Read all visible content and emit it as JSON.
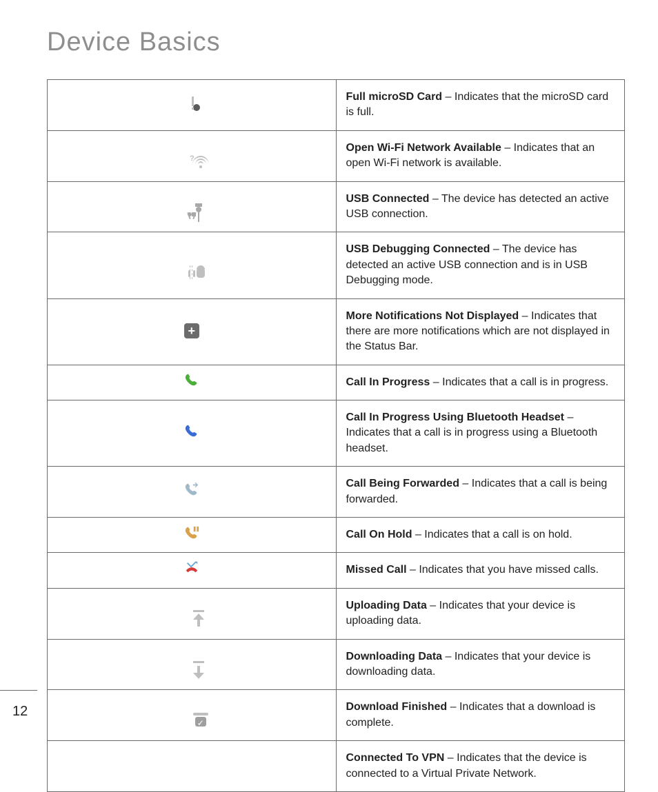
{
  "title": "Device Basics",
  "page_number": "12",
  "separator": " – ",
  "rows": [
    {
      "icon": "full-microsd-icon",
      "term": "Full microSD Card",
      "desc": "Indicates that the microSD card is full."
    },
    {
      "icon": "open-wifi-icon",
      "term": "Open Wi-Fi Network Available",
      "desc": "Indicates that an open Wi-Fi network is available."
    },
    {
      "icon": "usb-connected-icon",
      "term": "USB Connected",
      "desc": "The device has detected an active USB connection."
    },
    {
      "icon": "usb-debugging-icon",
      "term": "USB Debugging Connected",
      "desc": "The device has detected an active USB connection and is in USB Debugging mode."
    },
    {
      "icon": "more-notifications-icon",
      "term": "More Notifications Not Displayed",
      "desc": "Indicates that there are more notifications which are not displayed in the Status Bar."
    },
    {
      "icon": "call-in-progress-icon",
      "term": "Call In Progress",
      "desc": "Indicates that a call is in progress."
    },
    {
      "icon": "call-bluetooth-icon",
      "term": "Call In Progress Using Bluetooth Headset",
      "desc": "Indicates that a call is in progress using a Bluetooth headset."
    },
    {
      "icon": "call-forwarded-icon",
      "term": "Call Being Forwarded",
      "desc": "Indicates that a call is being forwarded."
    },
    {
      "icon": "call-on-hold-icon",
      "term": "Call On Hold",
      "desc": "Indicates that a call is on hold."
    },
    {
      "icon": "missed-call-icon",
      "term": "Missed Call",
      "desc": "Indicates that you have missed calls."
    },
    {
      "icon": "uploading-data-icon",
      "term": "Uploading Data",
      "desc": "Indicates that your device is uploading data."
    },
    {
      "icon": "downloading-data-icon",
      "term": "Downloading Data",
      "desc": "Indicates that your device is downloading data."
    },
    {
      "icon": "download-finished-icon",
      "term": "Download Finished",
      "desc": "Indicates that a download is complete."
    },
    {
      "icon": "connected-to-vpn-icon",
      "term": "Connected To VPN",
      "desc": "Indicates that the device is connected to a Virtual Private Network."
    }
  ],
  "colors": {
    "title": "#8e8e8e",
    "border": "#6a6a6a",
    "text": "#1a1a1a"
  }
}
